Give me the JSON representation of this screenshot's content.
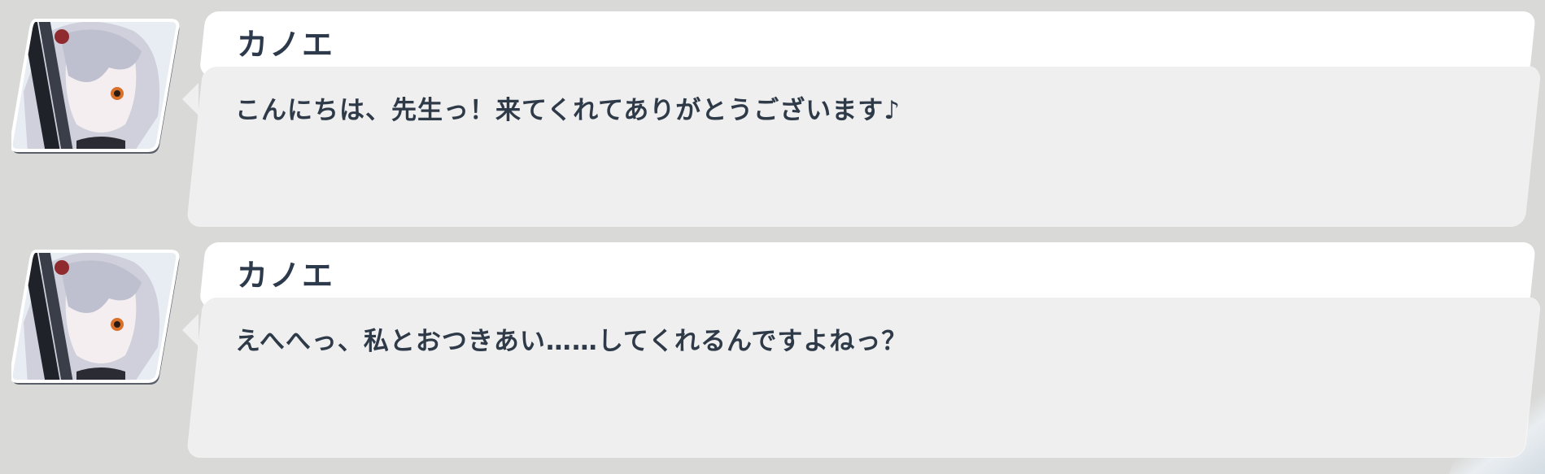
{
  "chat": {
    "messages": [
      {
        "speaker": "カノエ",
        "avatar_icon": "character-portrait-icon",
        "text": "こんにちは、先生っ！来てくれてありがとうございます♪"
      },
      {
        "speaker": "カノエ",
        "avatar_icon": "character-portrait-icon",
        "text": "えへへっ、私とおつきあい……してくれるんですよねっ？"
      }
    ]
  },
  "colors": {
    "background": "#d9d9d7",
    "bubble_header": "#ffffff",
    "bubble_body": "#efefef",
    "text": "#2f3a48"
  }
}
